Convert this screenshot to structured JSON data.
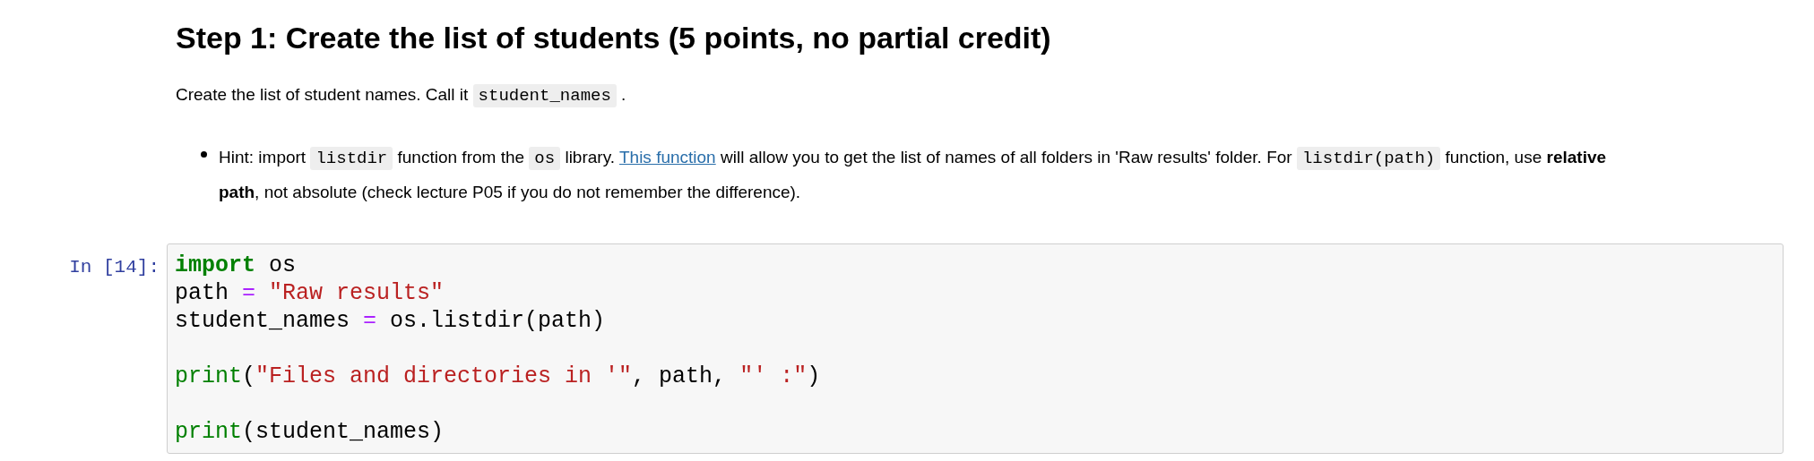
{
  "heading": "Step 1: Create the list of students (5 points, no partial credit)",
  "paragraph": [
    {
      "kind": "text",
      "text": "Create the list of student names. Call it "
    },
    {
      "kind": "code",
      "text": "student_names"
    },
    {
      "kind": "text",
      "text": " ."
    }
  ],
  "bullets": [
    [
      {
        "kind": "text",
        "text": "Hint: import "
      },
      {
        "kind": "code",
        "text": "listdir"
      },
      {
        "kind": "text",
        "text": " function from the "
      },
      {
        "kind": "code",
        "text": "os"
      },
      {
        "kind": "text",
        "text": " library. "
      },
      {
        "kind": "link",
        "text": "This function"
      },
      {
        "kind": "text",
        "text": " will allow you to get the list of names of all folders in 'Raw results' folder. For "
      },
      {
        "kind": "code",
        "text": "listdir(path)"
      },
      {
        "kind": "text",
        "text": " function, use "
      },
      {
        "kind": "bold",
        "text": "relative path"
      },
      {
        "kind": "text",
        "text": ", not absolute (check lecture P05 if you do not remember the difference)."
      }
    ]
  ],
  "cell": {
    "prompt": "In [14]:",
    "blocks": [
      [
        [
          {
            "kind": "keyword",
            "text": "import"
          },
          {
            "kind": "plain",
            "text": " os"
          }
        ],
        [
          {
            "kind": "plain",
            "text": "path "
          },
          {
            "kind": "operator",
            "text": "="
          },
          {
            "kind": "string",
            "text": " \"Raw results\""
          }
        ],
        [
          {
            "kind": "plain",
            "text": "student_names "
          },
          {
            "kind": "operator",
            "text": "="
          },
          {
            "kind": "plain",
            "text": " os.listdir(path)"
          }
        ]
      ],
      [
        [
          {
            "kind": "builtin",
            "text": "print"
          },
          {
            "kind": "plain",
            "text": "("
          },
          {
            "kind": "string",
            "text": "\"Files and directories in '\""
          },
          {
            "kind": "plain",
            "text": ", path, "
          },
          {
            "kind": "string",
            "text": "\"' :\""
          },
          {
            "kind": "plain",
            "text": ")"
          }
        ]
      ],
      [
        [
          {
            "kind": "builtin",
            "text": "print"
          },
          {
            "kind": "plain",
            "text": "(student_names)"
          }
        ]
      ]
    ]
  }
}
